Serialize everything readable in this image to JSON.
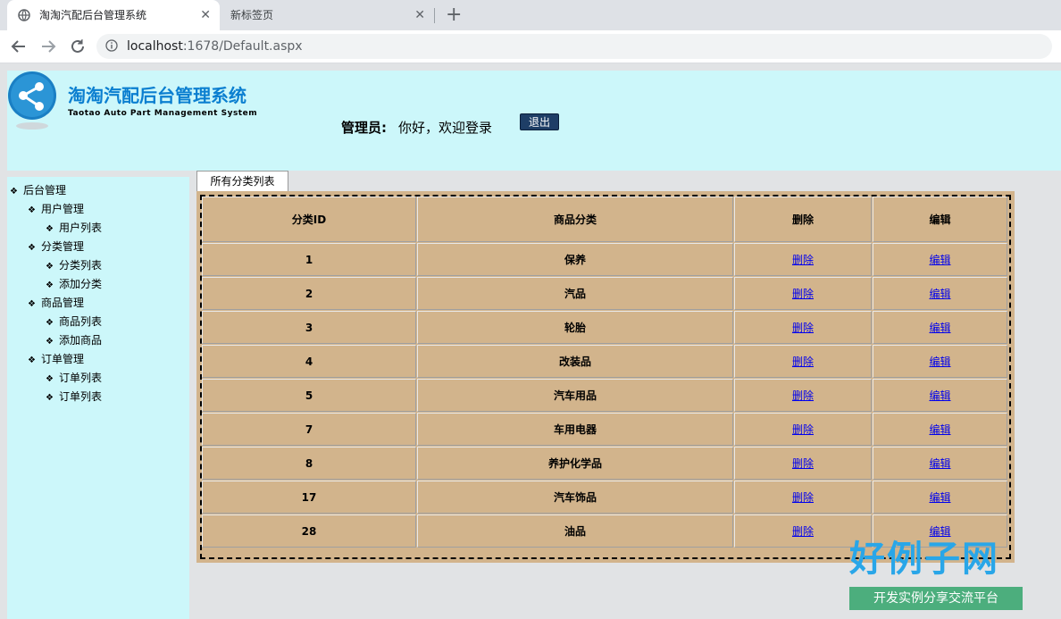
{
  "browser": {
    "active_tab_title": "淘淘汽配后台管理系统",
    "inactive_tab_title": "新标签页",
    "close_glyph": "✕",
    "new_tab_glyph": "+",
    "url_host": "localhost",
    "url_rest": ":1678/Default.aspx"
  },
  "header": {
    "system_title": "淘淘汽配后台管理系统",
    "system_subtitle": "Taotao Auto Part Management System",
    "admin_label": "管理员:",
    "admin_greeting": "你好，欢迎登录",
    "logout_label": "退出"
  },
  "sidebar": {
    "bullet": "❖",
    "root": "后台管理",
    "groups": [
      {
        "label": "用户管理",
        "items": [
          "用户列表"
        ]
      },
      {
        "label": "分类管理",
        "items": [
          "分类列表",
          "添加分类"
        ]
      },
      {
        "label": "商品管理",
        "items": [
          "商品列表",
          "添加商品"
        ]
      },
      {
        "label": "订单管理",
        "items": [
          "订单列表",
          "订单列表"
        ]
      }
    ]
  },
  "content": {
    "tab_label": "所有分类列表",
    "columns": [
      "分类ID",
      "商品分类",
      "删除",
      "编辑"
    ],
    "delete_link": "删除",
    "edit_link": "编辑",
    "rows": [
      {
        "id": "1",
        "name": "保养"
      },
      {
        "id": "2",
        "name": "汽品"
      },
      {
        "id": "3",
        "name": "轮胎"
      },
      {
        "id": "4",
        "name": "改装品"
      },
      {
        "id": "5",
        "name": "汽车用品"
      },
      {
        "id": "7",
        "name": "车用电器"
      },
      {
        "id": "8",
        "name": "养护化学品"
      },
      {
        "id": "17",
        "name": "汽车饰品"
      },
      {
        "id": "28",
        "name": "油品"
      }
    ]
  },
  "watermark": {
    "brand": "好例子网",
    "slogan": "开发实例分享交流平台"
  }
}
